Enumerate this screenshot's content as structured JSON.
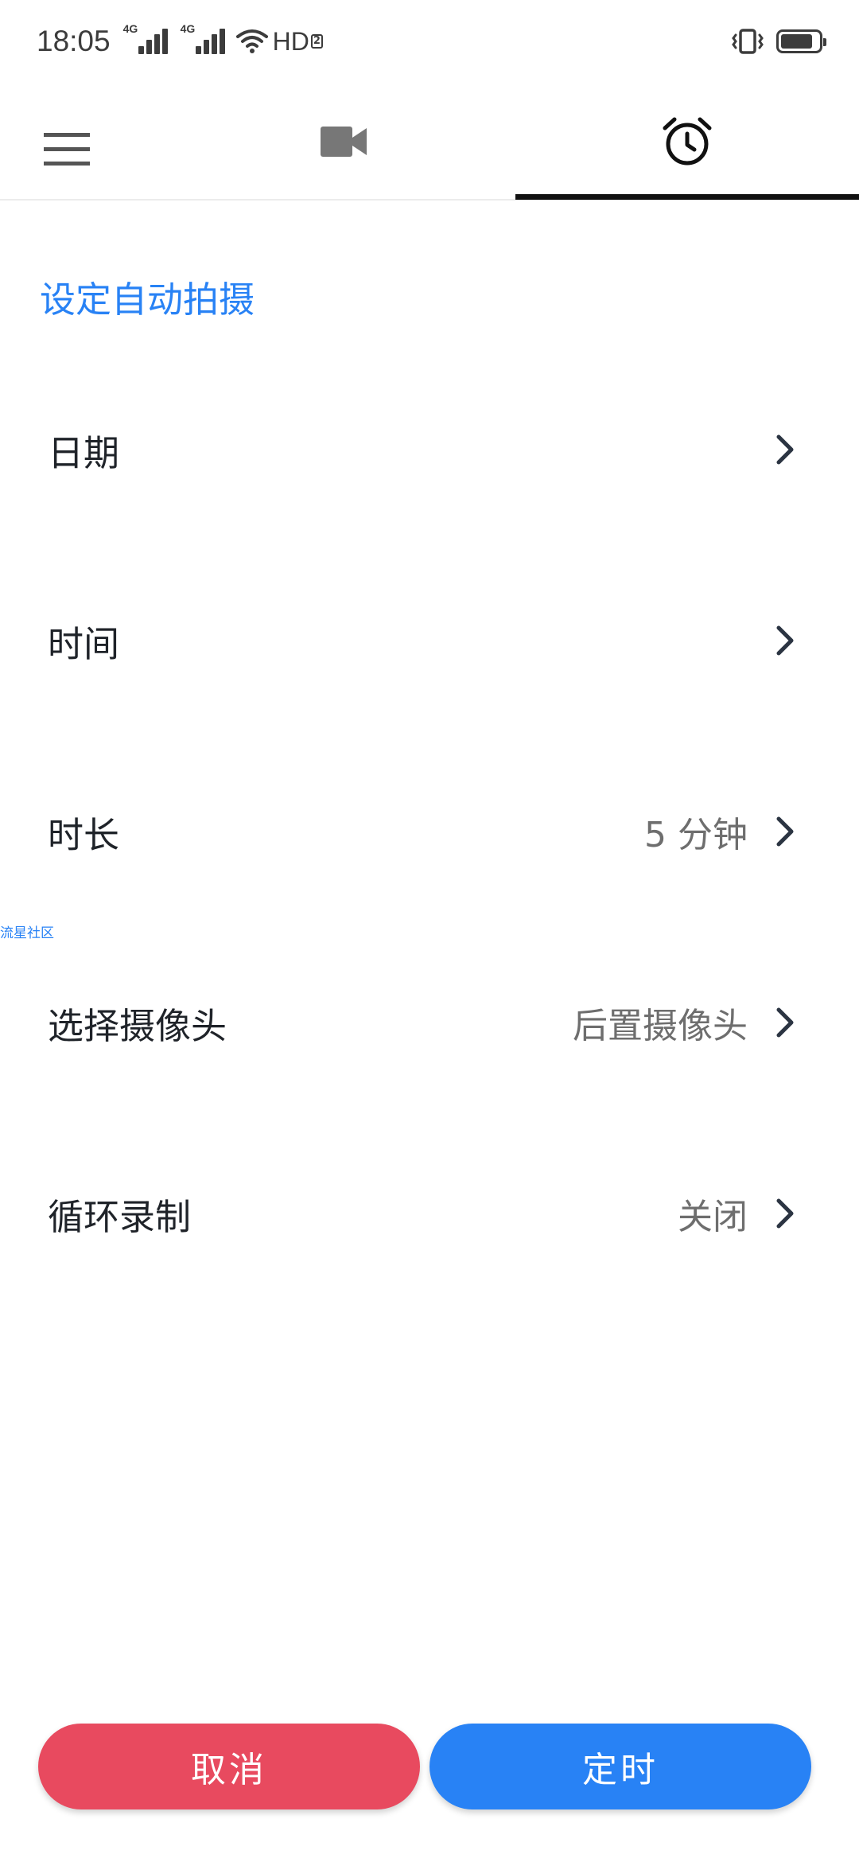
{
  "status_bar": {
    "time": "18:05",
    "signal1_tag": "4G",
    "signal2_tag": "4G",
    "hd_label": "HD",
    "hd_sub": "2",
    "battery_level": 0.85
  },
  "toolbar": {
    "menu_icon": "menu-icon",
    "tabs": [
      {
        "icon": "video-camera-icon",
        "selected": false
      },
      {
        "icon": "alarm-clock-icon",
        "selected": true
      }
    ]
  },
  "section_title": "设定自动拍摄",
  "settings": [
    {
      "label": "日期",
      "value": ""
    },
    {
      "label": "时间",
      "value": ""
    },
    {
      "label": "时长",
      "value": "5 分钟"
    },
    {
      "label": "选择摄像头",
      "value": "后置摄像头"
    },
    {
      "label": "循环录制",
      "value": "关闭"
    }
  ],
  "watermark": "流星社区",
  "buttons": {
    "cancel": "取消",
    "confirm": "定时"
  },
  "colors": {
    "accent": "#2882f5",
    "cancel": "#e84a5f",
    "text": "#1f2329",
    "secondary_text": "#6e6e6e"
  }
}
